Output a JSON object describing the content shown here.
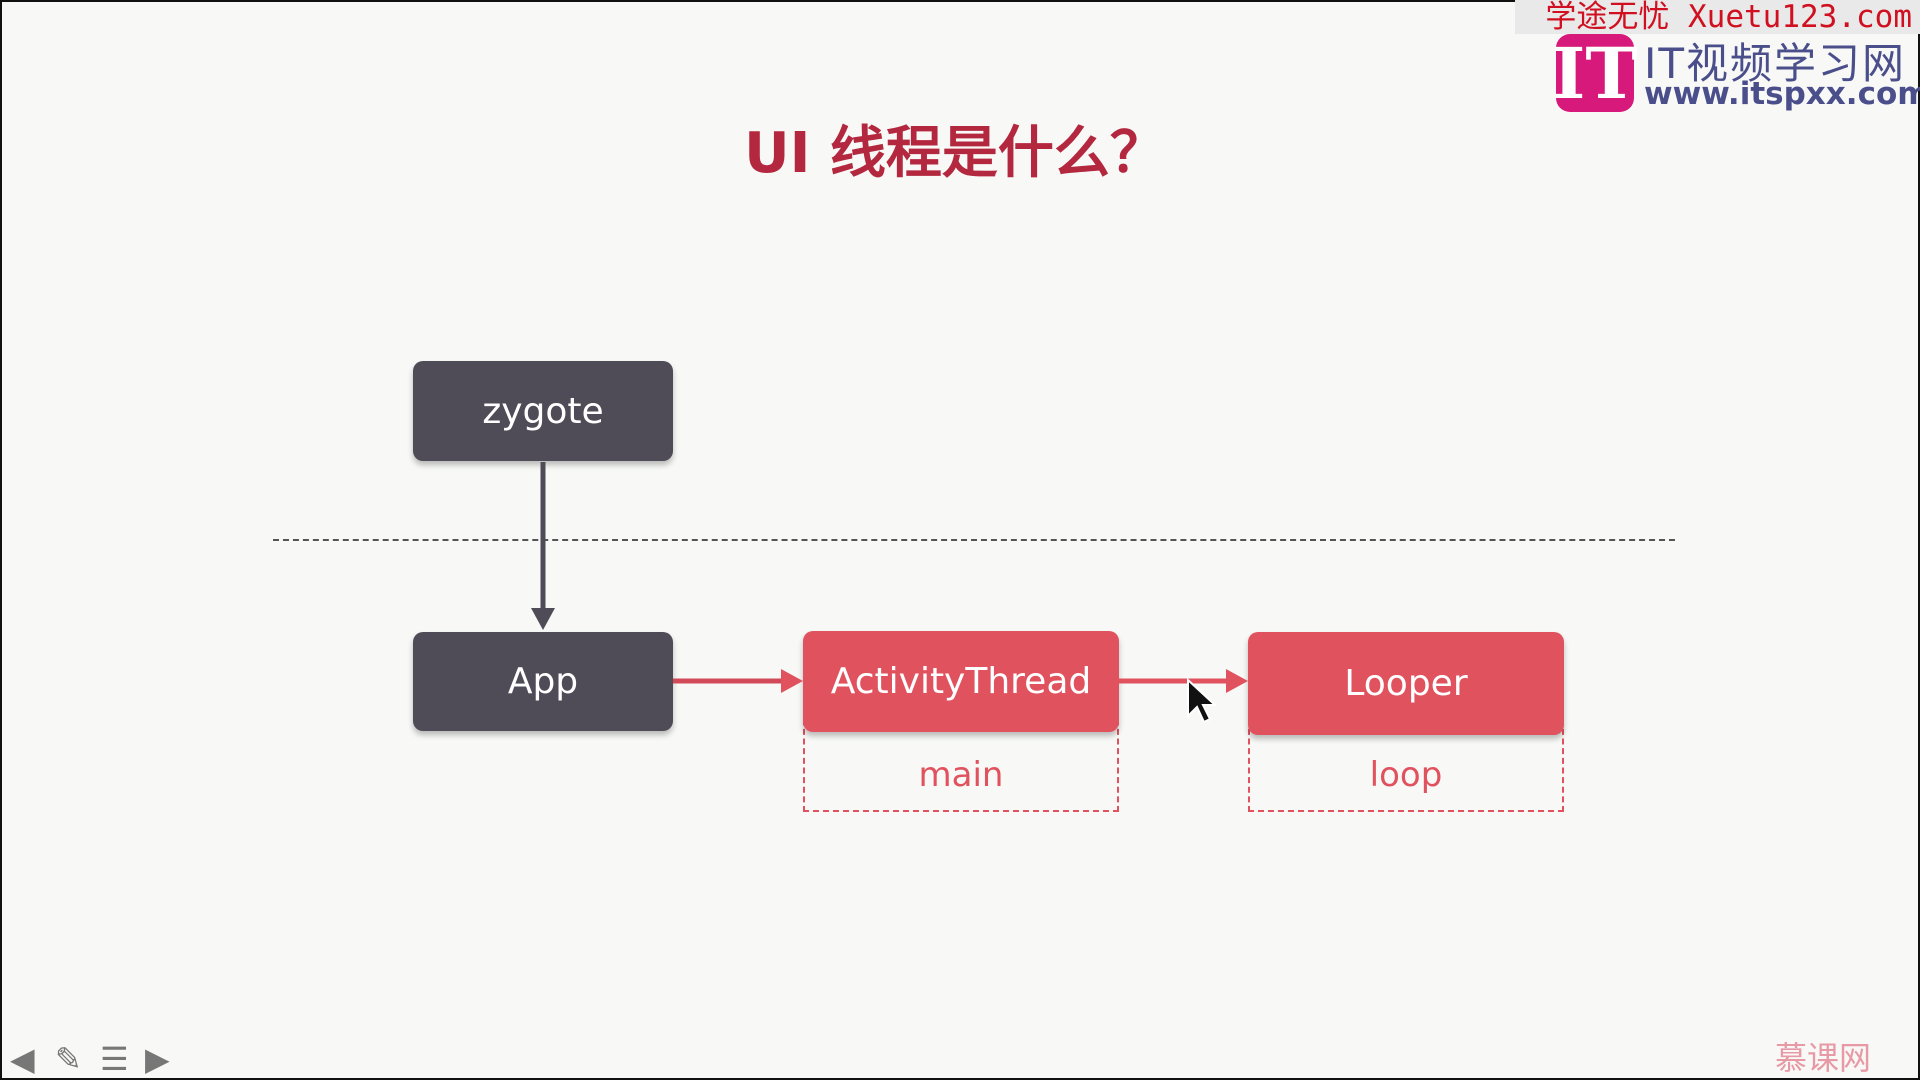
{
  "slide": {
    "title": "UI 线程是什么？"
  },
  "diagram": {
    "nodes": {
      "zygote": "zygote",
      "app": "App",
      "activity_thread": "ActivityThread",
      "looper": "Looper"
    },
    "methods": {
      "activity_thread": "main",
      "looper": "loop"
    }
  },
  "watermark": {
    "top": "学途无忧 Xuetu123.com",
    "logo_letter": "IT",
    "site_name": "IT视频学习网",
    "site_url": "www.itspxx.com",
    "bottom": "慕课网"
  },
  "controls": {
    "prev": "◀",
    "pen": "✎",
    "menu": "☰",
    "next": "▶"
  },
  "colors": {
    "title": "#b3283f",
    "dark_box": "#4f4c58",
    "red_box": "#e1525f"
  }
}
